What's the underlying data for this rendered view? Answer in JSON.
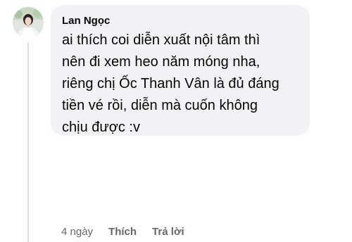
{
  "comment": {
    "author": "Lan Ngọc",
    "text": "ai thích coi diễn xuất nội tâm thì\nnên đi xem heo năm móng nha,\nriêng chị Ốc Thanh Vân là đủ đáng\ntiền vé rồi, diễn mà cuốn không\nchịu được :v",
    "time": "4 ngày",
    "like_label": "Thích",
    "reply_label": "Trả lời"
  },
  "colors": {
    "bubble_bg": "#f0f2f5",
    "text": "#050505",
    "meta": "#65676b",
    "thread_line": "#dadde1"
  }
}
